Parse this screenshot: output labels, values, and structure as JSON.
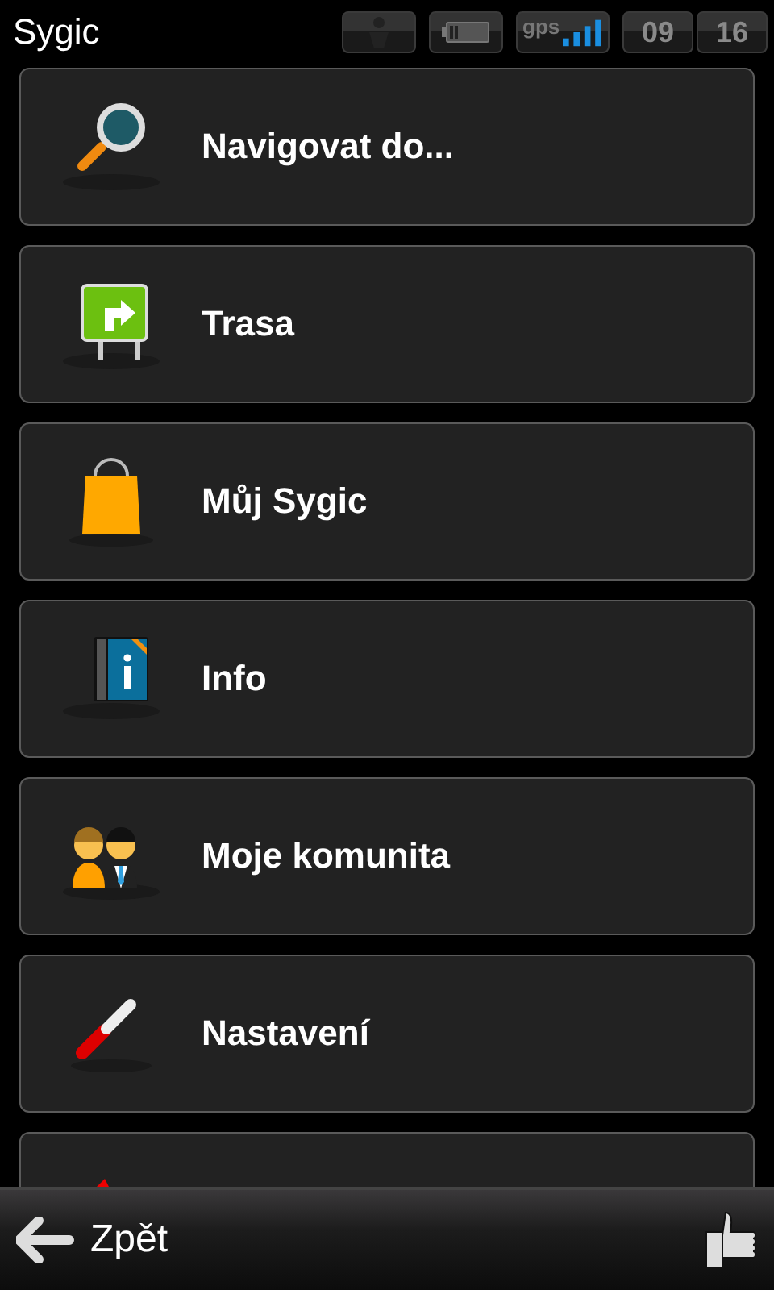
{
  "status_bar": {
    "title": "Sygic",
    "gps_label": "gps",
    "hours": "09",
    "minutes": "16"
  },
  "menu": [
    {
      "kind": "search",
      "label": "Navigovat do..."
    },
    {
      "kind": "sign",
      "label": "Trasa"
    },
    {
      "kind": "bag",
      "label": "Můj Sygic"
    },
    {
      "kind": "info",
      "label": "Info"
    },
    {
      "kind": "people",
      "label": "Moje komunita"
    },
    {
      "kind": "tool",
      "label": "Nastavení"
    },
    {
      "kind": "partial"
    }
  ],
  "bottom_bar": {
    "back": "Zpět"
  }
}
